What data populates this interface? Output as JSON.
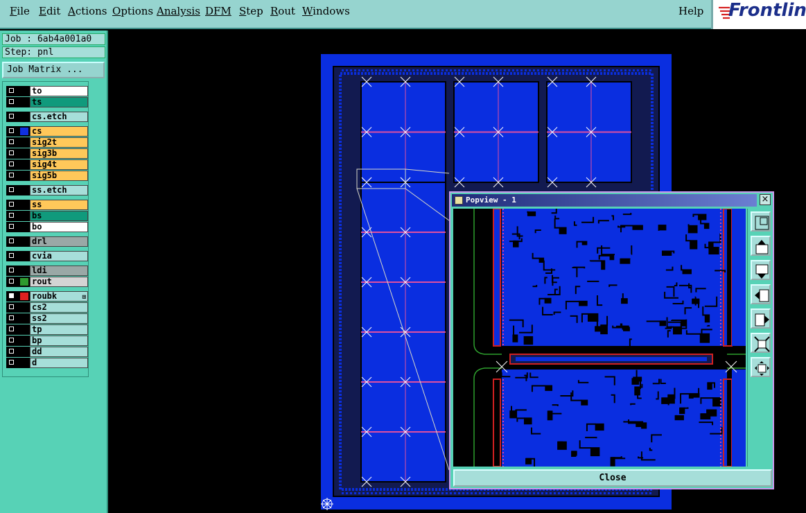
{
  "menu": {
    "items": [
      {
        "label": "File",
        "ul": "F",
        "rest": "ile"
      },
      {
        "label": "Edit",
        "ul": "E",
        "rest": "dit"
      },
      {
        "label": "Actions",
        "ul": "A",
        "rest": "ctions"
      },
      {
        "label": "Options",
        "ul": "O",
        "rest": "ptions"
      },
      {
        "label": "Analysis",
        "ul": "",
        "rest": "Analysis"
      },
      {
        "label": "DFM",
        "ul": "",
        "rest": "DFM"
      },
      {
        "label": "Step",
        "ul": "S",
        "rest": "tep"
      },
      {
        "label": "Rout",
        "ul": "R",
        "rest": "out"
      },
      {
        "label": "Windows",
        "ul": "W",
        "rest": "indows"
      }
    ],
    "help_label": "Help"
  },
  "logo": {
    "text": "Frontlin"
  },
  "job": {
    "text": "Job : 6ab4a001a0",
    "step_text": "Step: pnl",
    "matrix_button": "Job Matrix ..."
  },
  "layers": [
    {
      "name": "to",
      "color": "#ffffff",
      "swatch": "#000000",
      "checked": false
    },
    {
      "name": "ts",
      "color": "#109a7c",
      "swatch": "#000000",
      "checked": false
    },
    {
      "name": "cs.etch",
      "color": "#a6ded9",
      "swatch": "#000000",
      "checked": false
    },
    {
      "name": "cs",
      "color": "#ffc85a",
      "swatch": "#1030e0",
      "checked": false
    },
    {
      "name": "sig2t",
      "color": "#ffc85a",
      "swatch": "#000000",
      "checked": false
    },
    {
      "name": "sig3b",
      "color": "#ffc85a",
      "swatch": "#000000",
      "checked": false
    },
    {
      "name": "sig4t",
      "color": "#ffc85a",
      "swatch": "#000000",
      "checked": false
    },
    {
      "name": "sig5b",
      "color": "#ffc85a",
      "swatch": "#000000",
      "checked": false
    },
    {
      "name": "ss.etch",
      "color": "#a6ded9",
      "swatch": "#000000",
      "checked": false
    },
    {
      "name": "ss",
      "color": "#ffc85a",
      "swatch": "#000000",
      "checked": false
    },
    {
      "name": "bs",
      "color": "#109a7c",
      "swatch": "#000000",
      "checked": false
    },
    {
      "name": "bo",
      "color": "#ffffff",
      "swatch": "#000000",
      "checked": false
    },
    {
      "name": "drl",
      "color": "#9aa8a6",
      "swatch": "#000000",
      "checked": false
    },
    {
      "name": "cvia",
      "color": "#a6ded9",
      "swatch": "#000000",
      "checked": false
    },
    {
      "name": "ldi",
      "color": "#9aa8a6",
      "swatch": "#000000",
      "checked": false
    },
    {
      "name": "rout",
      "color": "#d4d4d4",
      "swatch": "#2e9a2e",
      "checked": false
    },
    {
      "name": "roubk",
      "color": "#a6ded9",
      "swatch": "#e02020",
      "checked": true,
      "mark": "⊞"
    },
    {
      "name": "cs2",
      "color": "#a6ded9",
      "swatch": "#000000",
      "checked": false
    },
    {
      "name": "ss2",
      "color": "#a6ded9",
      "swatch": "#000000",
      "checked": false
    },
    {
      "name": "tp",
      "color": "#a6ded9",
      "swatch": "#000000",
      "checked": false
    },
    {
      "name": "bp",
      "color": "#a6ded9",
      "swatch": "#000000",
      "checked": false
    },
    {
      "name": "dd",
      "color": "#a6ded9",
      "swatch": "#000000",
      "checked": false
    },
    {
      "name": "d",
      "color": "#a6ded9",
      "swatch": "#000000",
      "checked": false
    }
  ],
  "popup": {
    "title": "Popview - 1",
    "close_x": "×",
    "close_label": "Close"
  },
  "tools": [
    "zoom-fit-icon",
    "pan-up-icon",
    "pan-down-icon",
    "pan-left-icon",
    "pan-right-icon",
    "zoom-out-icon",
    "zoom-in-icon"
  ],
  "colors": {
    "panel": "#57d2b6",
    "menubar": "#96d4cf",
    "board_blue": "#0a2ee0"
  }
}
